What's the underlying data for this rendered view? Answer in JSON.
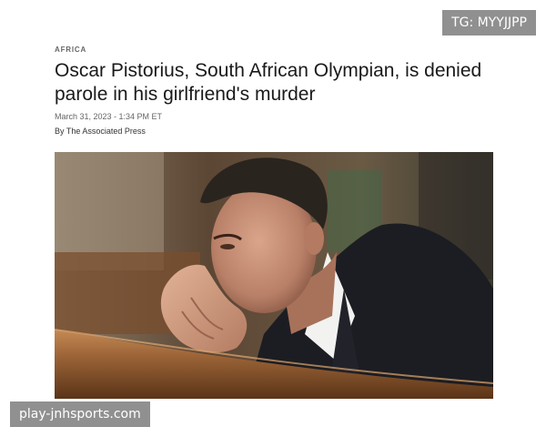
{
  "overlays": {
    "top_right": "TG: MYYJJPP",
    "bottom_left": "play-jnhsports.com"
  },
  "article": {
    "section": "AFRICA",
    "headline": "Oscar Pistorius, South African Olympian, is denied parole in his girlfriend's murder",
    "date": "March 31, 2023 - 1:34 PM ET",
    "byline": "By The Associated Press"
  },
  "photo": {
    "subject": "man-in-courtroom-hand-on-face-photo"
  }
}
